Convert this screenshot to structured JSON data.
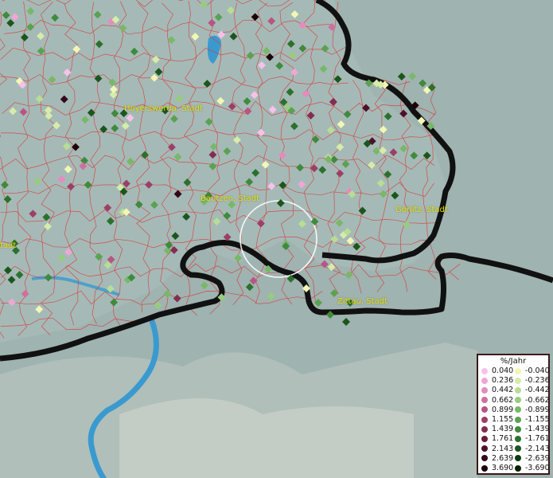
{
  "map": {
    "city_labels": [
      {
        "id": "hoyerswerda",
        "text": "Hoyerswerda, Stadt"
      },
      {
        "id": "bautzen",
        "text": "Bautzen, Stadt"
      },
      {
        "id": "goerlitz",
        "text": "Görlitz, Stadt"
      },
      {
        "id": "zittau",
        "text": "Zittau, Stadt"
      },
      {
        "id": "edge",
        "text": "tadt"
      }
    ],
    "colors": {
      "terrain": "#9fb3b0",
      "district_border": "#d83a3a",
      "country_border": "#111111",
      "river": "#3a9ad0",
      "label": "#e8e000"
    }
  },
  "legend": {
    "title": "%/Jahr",
    "positive": [
      {
        "value": "0.040",
        "color": "#f6c2ea"
      },
      {
        "value": "0.236",
        "color": "#eea7d4"
      },
      {
        "value": "0.442",
        "color": "#e38cbd"
      },
      {
        "value": "0.662",
        "color": "#d06f9f"
      },
      {
        "value": "0.899",
        "color": "#b85582"
      },
      {
        "value": "1.155",
        "color": "#9c3f67"
      },
      {
        "value": "1.439",
        "color": "#822d52"
      },
      {
        "value": "1.761",
        "color": "#671d3d"
      },
      {
        "value": "2.143",
        "color": "#4c112a"
      },
      {
        "value": "2.639",
        "color": "#330818"
      },
      {
        "value": "3.690",
        "color": "#1c0208"
      }
    ],
    "negative": [
      {
        "value": "-0.040",
        "color": "#f2f7b4"
      },
      {
        "value": "-0.236",
        "color": "#d6eca8"
      },
      {
        "value": "-0.442",
        "color": "#b8dd94"
      },
      {
        "value": "-0.662",
        "color": "#98cc7e"
      },
      {
        "value": "-0.899",
        "color": "#78b868"
      },
      {
        "value": "-1.155",
        "color": "#5aa251"
      },
      {
        "value": "-1.439",
        "color": "#408a3d"
      },
      {
        "value": "-1.761",
        "color": "#2b712c"
      },
      {
        "value": "-2.143",
        "color": "#1b561c"
      },
      {
        "value": "-2.639",
        "color": "#0e3c10"
      },
      {
        "value": "-3.690",
        "color": "#052205"
      }
    ]
  }
}
